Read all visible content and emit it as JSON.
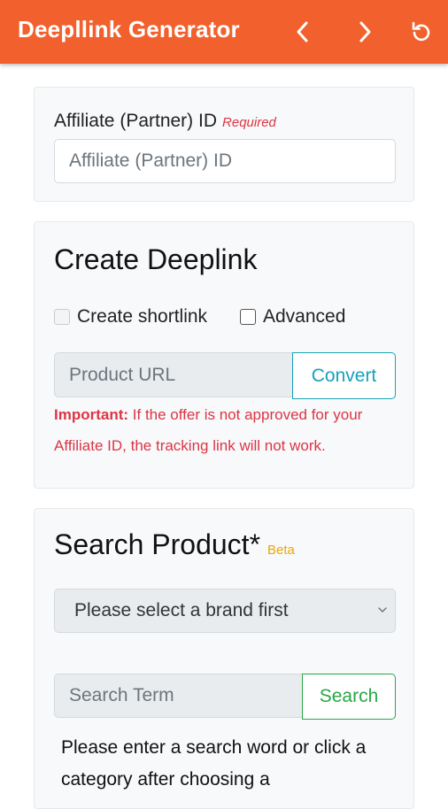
{
  "appbar": {
    "title": "Deepllink Generator",
    "back_icon": "chevron-left-icon",
    "forward_icon": "chevron-right-icon",
    "reload_icon": "reload-icon",
    "color": "#f2612d"
  },
  "affiliate": {
    "label": "Affiliate (Partner) ID",
    "required": "Required",
    "placeholder": "Affiliate (Partner) ID"
  },
  "deeplink": {
    "title": "Create Deeplink",
    "shortlink_label": "Create shortlink",
    "advanced_label": "Advanced",
    "url_placeholder": "Product URL",
    "convert_label": "Convert",
    "important_label": "Important:",
    "important_text": " If the offer is not approved for your Affiliate ID, the tracking link will not work."
  },
  "search": {
    "title": "Search Product*",
    "beta": "Beta",
    "brand_select": "Please select a brand first",
    "term_placeholder": "Search Term",
    "search_label": "Search",
    "info_text": "Please enter a search word or click a category after choosing a"
  },
  "colors": {
    "accent": "#f2612d",
    "convert": "#17a2b8",
    "search": "#28a745",
    "danger": "#dc3545",
    "beta": "#f0a500"
  }
}
